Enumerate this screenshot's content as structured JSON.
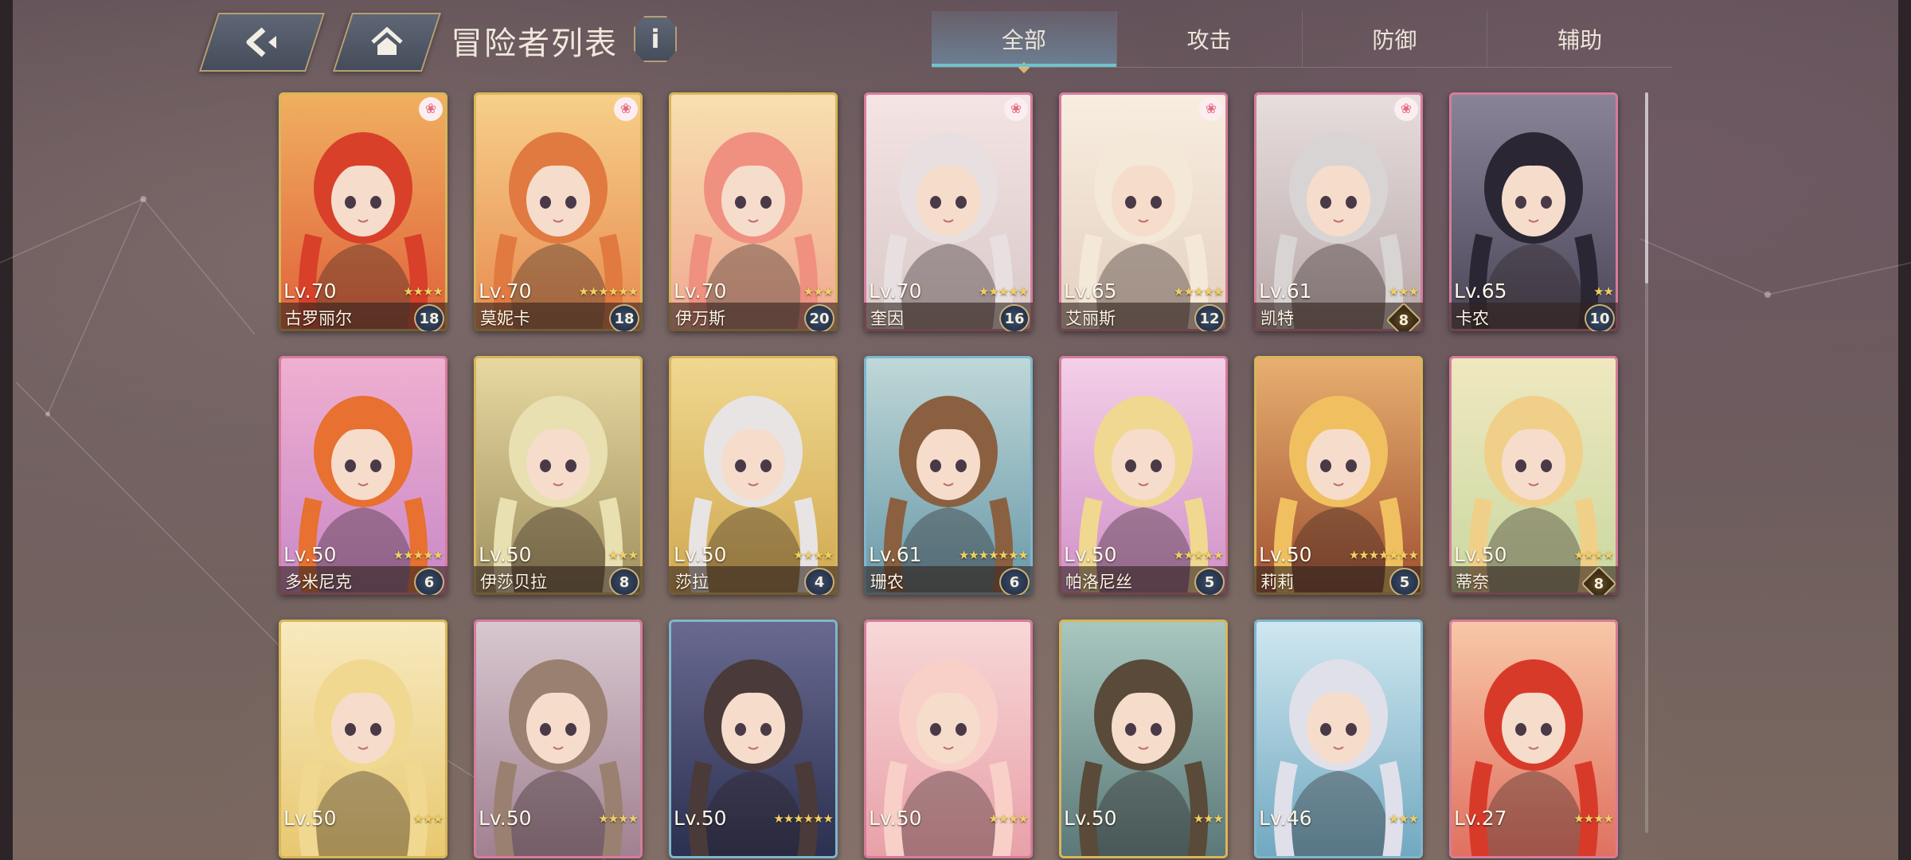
{
  "header": {
    "back_icon": "back-arrow-icon",
    "home_icon": "home-icon",
    "title": "冒险者列表",
    "info_label": "i"
  },
  "tabs": [
    {
      "label": "全部",
      "active": true
    },
    {
      "label": "攻击",
      "active": false
    },
    {
      "label": "防御",
      "active": false
    },
    {
      "label": "辅助",
      "active": false
    }
  ],
  "colors": {
    "frame_gold": "#d8b65a",
    "frame_pink": "#d67c9c",
    "frame_blue": "#7fb6cf",
    "tab_active": "#6fc3c9"
  },
  "cards": [
    {
      "name": "古罗丽尔",
      "level": "Lv.70",
      "stars": 4,
      "badge": "18",
      "badge_shape": "circle",
      "paw": true,
      "frame": "gold",
      "c1": "#e0603a",
      "c2": "#f0b060",
      "hair": "#d8402a"
    },
    {
      "name": "莫妮卡",
      "level": "Lv.70",
      "stars": 6,
      "badge": "18",
      "badge_shape": "circle",
      "paw": true,
      "frame": "gold",
      "c1": "#e88a50",
      "c2": "#f6d08a",
      "hair": "#e07a40"
    },
    {
      "name": "伊万斯",
      "level": "Lv.70",
      "stars": 3,
      "badge": "20",
      "badge_shape": "circle",
      "paw": false,
      "frame": "gold",
      "c1": "#f0a890",
      "c2": "#f8e0b0",
      "hair": "#f09080"
    },
    {
      "name": "奎因",
      "level": "Lv.70",
      "stars": 5,
      "badge": "16",
      "badge_shape": "circle",
      "paw": true,
      "frame": "pink",
      "c1": "#d8c8c8",
      "c2": "#f4e4e4",
      "hair": "#e8e0e0"
    },
    {
      "name": "艾丽斯",
      "level": "Lv.65",
      "stars": 5,
      "badge": "12",
      "badge_shape": "circle",
      "paw": true,
      "frame": "pink",
      "c1": "#e4d0c0",
      "c2": "#f8eee0",
      "hair": "#f4e8d8"
    },
    {
      "name": "凯特",
      "level": "Lv.61",
      "stars": 3,
      "badge": "8",
      "badge_shape": "diamond",
      "paw": true,
      "frame": "pink",
      "c1": "#b8a8a8",
      "c2": "#e8dede",
      "hair": "#d8d4d4"
    },
    {
      "name": "卡农",
      "level": "Lv.65",
      "stars": 2,
      "badge": "10",
      "badge_shape": "circle",
      "paw": false,
      "frame": "pink",
      "c1": "#4a4658",
      "c2": "#8a8498",
      "hair": "#2a2634"
    },
    {
      "name": "多米尼克",
      "level": "Lv.50",
      "stars": 5,
      "badge": "6",
      "badge_shape": "circle",
      "paw": false,
      "frame": "pink",
      "c1": "#c888c8",
      "c2": "#f0b0d0",
      "hair": "#e87030"
    },
    {
      "name": "伊莎贝拉",
      "level": "Lv.50",
      "stars": 3,
      "badge": "8",
      "badge_shape": "circle",
      "paw": false,
      "frame": "gold",
      "c1": "#a09060",
      "c2": "#e8d8a0",
      "hair": "#e8e0b0"
    },
    {
      "name": "莎拉",
      "level": "Lv.50",
      "stars": 4,
      "badge": "4",
      "badge_shape": "circle",
      "paw": false,
      "frame": "gold",
      "c1": "#d0a850",
      "c2": "#f0d890",
      "hair": "#e8e4e4"
    },
    {
      "name": "珊农",
      "level": "Lv.61",
      "stars": 7,
      "badge": "6",
      "badge_shape": "circle",
      "paw": false,
      "frame": "blue",
      "c1": "#6898a8",
      "c2": "#c0d8d8",
      "hair": "#8a6040"
    },
    {
      "name": "帕洛尼丝",
      "level": "Lv.50",
      "stars": 5,
      "badge": "5",
      "badge_shape": "circle",
      "paw": false,
      "frame": "pink",
      "c1": "#d090c8",
      "c2": "#f4d0e8",
      "hair": "#f0d890"
    },
    {
      "name": "莉莉",
      "level": "Lv.50",
      "stars": 7,
      "badge": "5",
      "badge_shape": "circle",
      "paw": false,
      "frame": "gold",
      "c1": "#a05030",
      "c2": "#e8b070",
      "hair": "#f0c060"
    },
    {
      "name": "蒂奈",
      "level": "Lv.50",
      "stars": 4,
      "badge": "8",
      "badge_shape": "diamond",
      "paw": false,
      "frame": "pink",
      "c1": "#c8d8a0",
      "c2": "#f0e8c0",
      "hair": "#f0d088"
    },
    {
      "name": "",
      "level": "Lv.50",
      "stars": 3,
      "badge": "",
      "badge_shape": "none",
      "paw": false,
      "frame": "gold",
      "c1": "#e8c870",
      "c2": "#f8eac0",
      "hair": "#f0d890"
    },
    {
      "name": "",
      "level": "Lv.50",
      "stars": 4,
      "badge": "",
      "badge_shape": "none",
      "paw": false,
      "frame": "pink",
      "c1": "#a08090",
      "c2": "#d8c8d0",
      "hair": "#9a8070"
    },
    {
      "name": "",
      "level": "Lv.50",
      "stars": 6,
      "badge": "",
      "badge_shape": "none",
      "paw": false,
      "frame": "blue",
      "c1": "#2a3050",
      "c2": "#6a6a90",
      "hair": "#4a3a3a"
    },
    {
      "name": "",
      "level": "Lv.50",
      "stars": 4,
      "badge": "",
      "badge_shape": "none",
      "paw": false,
      "frame": "pink",
      "c1": "#e8a0a8",
      "c2": "#f8d8d8",
      "hair": "#f8d0c8"
    },
    {
      "name": "",
      "level": "Lv.50",
      "stars": 3,
      "badge": "",
      "badge_shape": "none",
      "paw": false,
      "frame": "gold",
      "c1": "#5a7878",
      "c2": "#a8c8c0",
      "hair": "#5a4a3a"
    },
    {
      "name": "",
      "level": "Lv.46",
      "stars": 3,
      "badge": "",
      "badge_shape": "none",
      "paw": false,
      "frame": "blue",
      "c1": "#70a8c0",
      "c2": "#d0e8f0",
      "hair": "#e0e0ea"
    },
    {
      "name": "",
      "level": "Lv.27",
      "stars": 4,
      "badge": "",
      "badge_shape": "none",
      "paw": false,
      "frame": "pink",
      "c1": "#e07060",
      "c2": "#f8c8a8",
      "hair": "#d83a2a"
    }
  ]
}
